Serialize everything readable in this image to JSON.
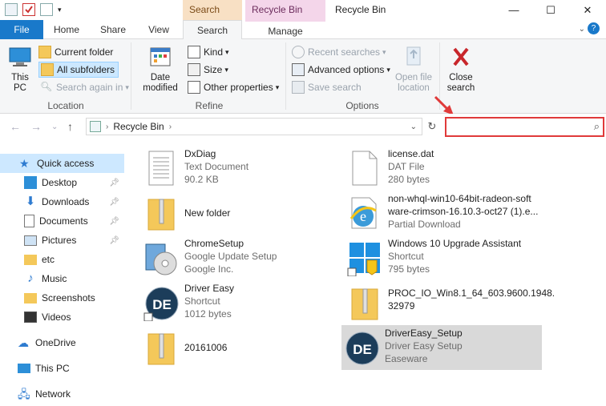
{
  "window": {
    "title": "Recycle Bin",
    "context_tab_search_tools": "Search Tools",
    "context_tab_recycle_bin_tools": "Recycle Bin Tools",
    "minimize": "—",
    "maximize": "☐",
    "close": "✕"
  },
  "tabs": {
    "file": "File",
    "home": "Home",
    "share": "Share",
    "view": "View",
    "search": "Search",
    "manage": "Manage"
  },
  "ribbon": {
    "location": {
      "label": "Location",
      "this_pc": "This PC",
      "current_folder": "Current folder",
      "all_subfolders": "All subfolders",
      "search_again_in": "Search again in"
    },
    "refine": {
      "label": "Refine",
      "date_modified": "Date modified",
      "kind": "Kind",
      "size": "Size",
      "other_properties": "Other properties"
    },
    "options": {
      "label": "Options",
      "recent_searches": "Recent searches",
      "advanced_options": "Advanced options",
      "save_search": "Save search",
      "open_file_location": "Open file location"
    },
    "close_search": "Close search"
  },
  "address": {
    "path": "Recycle Bin",
    "search_value": ""
  },
  "sidebar": {
    "quick_access": "Quick access",
    "items": [
      {
        "label": "Desktop",
        "icon": "desktop-icon",
        "pinned": true
      },
      {
        "label": "Downloads",
        "icon": "downloads-icon",
        "pinned": true
      },
      {
        "label": "Documents",
        "icon": "documents-icon",
        "pinned": true
      },
      {
        "label": "Pictures",
        "icon": "pictures-icon",
        "pinned": true
      },
      {
        "label": "etc",
        "icon": "folder-icon",
        "pinned": false
      },
      {
        "label": "Music",
        "icon": "music-icon",
        "pinned": false
      },
      {
        "label": "Screenshots",
        "icon": "folder-icon",
        "pinned": false
      },
      {
        "label": "Videos",
        "icon": "videos-icon",
        "pinned": false
      }
    ],
    "onedrive": "OneDrive",
    "this_pc": "This PC",
    "network": "Network"
  },
  "files": [
    {
      "name": "DxDiag",
      "type": "Text Document",
      "size": "90.2 KB",
      "icon": "text-document-icon"
    },
    {
      "name": "license.dat",
      "type": "DAT File",
      "size": "280 bytes",
      "icon": "blank-file-icon"
    },
    {
      "name": "New folder",
      "type": "",
      "size": "",
      "icon": "zip-folder-icon"
    },
    {
      "name": "non-whql-win10-64bit-radeon-soft",
      "name2": "ware-crimson-16.10.3-oct27 (1).e...",
      "type": "Partial Download",
      "size": "",
      "icon": "ie-download-icon"
    },
    {
      "name": "ChromeSetup",
      "type": "Google Update Setup",
      "size": "Google Inc.",
      "icon": "setup-disc-icon"
    },
    {
      "name": "Windows 10 Upgrade Assistant",
      "type": "Shortcut",
      "size": "795 bytes",
      "icon": "windows-logo-icon"
    },
    {
      "name": "Driver Easy",
      "type": "Shortcut",
      "size": "1012 bytes",
      "icon": "drivereasy-icon"
    },
    {
      "name": "PROC_IO_Win8.1_64_603.9600.1948.",
      "name2": "32979",
      "type": "",
      "size": "",
      "icon": "zip-folder-icon"
    },
    {
      "name": "20161006",
      "type": "",
      "size": "",
      "icon": "zip-folder-icon"
    },
    {
      "name": "DriverEasy_Setup",
      "type": "Driver Easy Setup",
      "size": "Easeware",
      "icon": "drivereasy-icon"
    }
  ],
  "colors": {
    "file_tab": "#1979ca",
    "search_tools": "#f8e0c4",
    "recycle_bin_tools": "#f4d6ea",
    "highlight": "#e03a3a",
    "selection": "#cde8ff"
  }
}
